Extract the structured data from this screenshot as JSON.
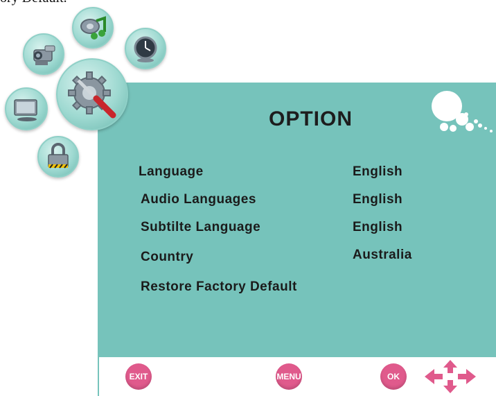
{
  "caption": "ory Default.",
  "title": "OPTION",
  "menu": {
    "items": [
      {
        "label": "Language",
        "value": "English"
      },
      {
        "label": "Audio Languages",
        "value": "English"
      },
      {
        "label": "Subtilte Language",
        "value": "English"
      },
      {
        "label": "Country",
        "value": "Australia"
      },
      {
        "label": "Restore Factory Default",
        "value": ""
      }
    ]
  },
  "footer": {
    "exit_label": "EXIT",
    "menu_label": "MENU",
    "ok_label": "OK"
  },
  "icons": {
    "music": "music-icon",
    "camcorder": "camcorder-icon",
    "clock": "clock-icon",
    "settings": "settings-tools-icon",
    "monitor": "monitor-icon",
    "lock": "lock-icon",
    "bubbles": "bubbles-decoration-icon",
    "arrows": "directional-arrows-icon"
  },
  "colors": {
    "panel": "#76c3bb",
    "button": "#e05a8c"
  }
}
